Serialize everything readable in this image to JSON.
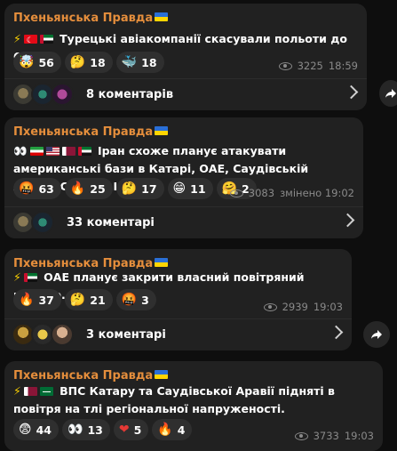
{
  "channel_name": "Пхеньянська Правда",
  "posts": [
    {
      "text": "Турецькі авіакомпанії скасували польоти до ОАЕ.",
      "reactions": [
        {
          "emoji": "🤯",
          "count": "56"
        },
        {
          "emoji": "🤔",
          "count": "18"
        },
        {
          "emoji": "🐳",
          "count": "18"
        }
      ],
      "views": "3225",
      "time": "18:59",
      "comments_label": "8 коментарів"
    },
    {
      "text": "Іран схоже планує атакувати американські бази в Катарі, ОАЕ, Саудівській Аравії, Сирії та Іраку.",
      "reactions": [
        {
          "emoji": "🤬",
          "count": "63"
        },
        {
          "emoji": "🔥",
          "count": "25"
        },
        {
          "emoji": "🤔",
          "count": "17"
        },
        {
          "emoji": "😁",
          "count": "11"
        },
        {
          "emoji": "🤗",
          "count": "2"
        }
      ],
      "views": "3083",
      "time": "змінено 19:02",
      "comments_label": "33 коментарі"
    },
    {
      "text": "ОАЕ планує закрити власний повітряний простір.",
      "reactions": [
        {
          "emoji": "🔥",
          "count": "37"
        },
        {
          "emoji": "🤔",
          "count": "21"
        },
        {
          "emoji": "🤬",
          "count": "3"
        }
      ],
      "views": "2939",
      "time": "19:03",
      "comments_label": "3 коментарі"
    },
    {
      "text": "ВПС Катару та Саудівської Аравії підняті в повітря на тлі регіональної напруженості.",
      "reactions": [
        {
          "emoji": "😨",
          "count": "44"
        },
        {
          "emoji": "👀",
          "count": "13"
        },
        {
          "emoji": "❤",
          "count": "5"
        },
        {
          "emoji": "🔥",
          "count": "4"
        }
      ],
      "views": "3733",
      "time": "19:03"
    }
  ],
  "colors": {
    "accent": "#e58e3c",
    "bubble": "#212121",
    "background": "#0e0e0e"
  }
}
